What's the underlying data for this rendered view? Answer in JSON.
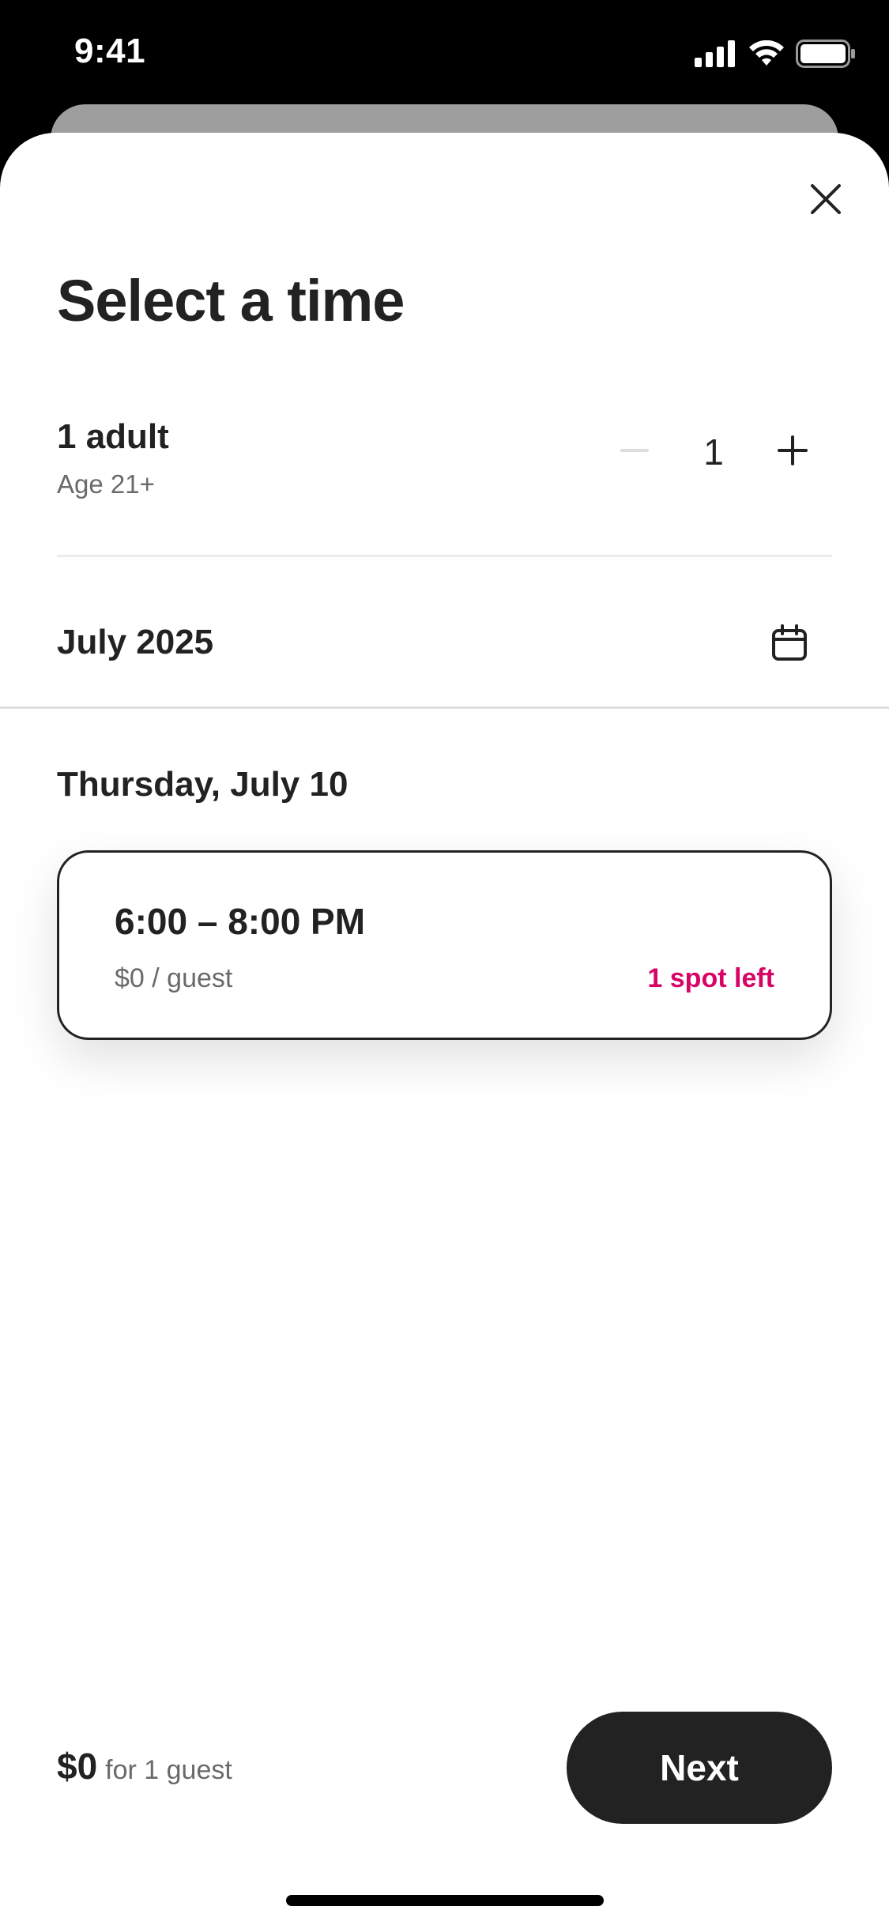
{
  "status_bar": {
    "time": "9:41",
    "icons": [
      "cellular-signal-icon",
      "wifi-icon",
      "battery-icon"
    ]
  },
  "sheet": {
    "title": "Select a time",
    "close_icon": "close-icon"
  },
  "guests": {
    "label": "1 adult",
    "sublabel": "Age 21+",
    "value": "1",
    "decrement_icon": "minus-icon",
    "increment_icon": "plus-icon"
  },
  "month": {
    "label": "July 2025",
    "icon": "calendar-icon"
  },
  "date_heading": "Thursday, July 10",
  "slots": [
    {
      "time": "6:00 – 8:00 PM",
      "price": "$0  / guest",
      "availability": "1 spot left"
    }
  ],
  "footer": {
    "price": "$0",
    "price_sub": "for 1 guest",
    "next_label": "Next"
  },
  "colors": {
    "text_primary": "#222222",
    "text_secondary": "#6a6a6a",
    "availability": "#d70466",
    "button_bg": "#222222"
  }
}
